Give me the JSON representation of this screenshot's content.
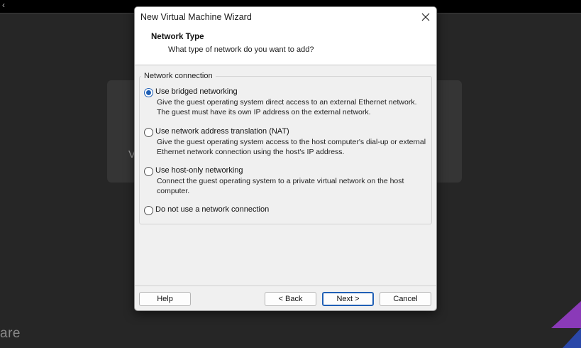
{
  "background": {
    "brand_text": "are",
    "panel_text": "V"
  },
  "dialog": {
    "title": "New Virtual Machine Wizard",
    "header_title": "Network Type",
    "header_subtitle": "What type of network do you want to add?",
    "group_label": "Network connection",
    "options": [
      {
        "label": "Use bridged networking",
        "description": "Give the guest operating system direct access to an external Ethernet network. The guest must have its own IP address on the external network.",
        "selected": true
      },
      {
        "label": "Use network address translation (NAT)",
        "description": "Give the guest operating system access to the host computer's dial-up or external Ethernet network connection using the host's IP address.",
        "selected": false
      },
      {
        "label": "Use host-only networking",
        "description": "Connect the guest operating system to a private virtual network on the host computer.",
        "selected": false
      },
      {
        "label": "Do not use a network connection",
        "description": "",
        "selected": false
      }
    ],
    "buttons": {
      "help": "Help",
      "back": "< Back",
      "next": "Next >",
      "cancel": "Cancel"
    }
  },
  "colors": {
    "accent": "#1f5fb5",
    "backdrop": "#262626",
    "corner_purple": "#8a3ab8",
    "corner_blue": "#2a47a8"
  },
  "icons": {
    "close": "close-icon",
    "back": "chevron-left-icon"
  }
}
